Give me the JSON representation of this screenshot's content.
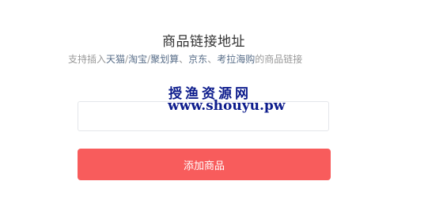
{
  "header": {
    "title": "商品链接地址",
    "subtitle_parts": [
      {
        "text": "支持插入",
        "highlight": false
      },
      {
        "text": "天猫",
        "highlight": true
      },
      {
        "text": "/",
        "highlight": false
      },
      {
        "text": "淘宝",
        "highlight": true
      },
      {
        "text": "/",
        "highlight": false
      },
      {
        "text": "聚划算",
        "highlight": true
      },
      {
        "text": "、",
        "highlight": false
      },
      {
        "text": "京东",
        "highlight": true
      },
      {
        "text": "、",
        "highlight": false
      },
      {
        "text": "考拉海购",
        "highlight": true
      },
      {
        "text": "的商品链接",
        "highlight": false
      }
    ]
  },
  "watermark": {
    "chinese": "授渔资源网",
    "url": "www.shouyu.pw"
  },
  "form": {
    "link_input_value": ""
  },
  "actions": {
    "add_label": "添加商品"
  },
  "colors": {
    "button": "#f85c5c",
    "highlight": "#5a6f8a",
    "watermark": "#0d1c8c"
  }
}
